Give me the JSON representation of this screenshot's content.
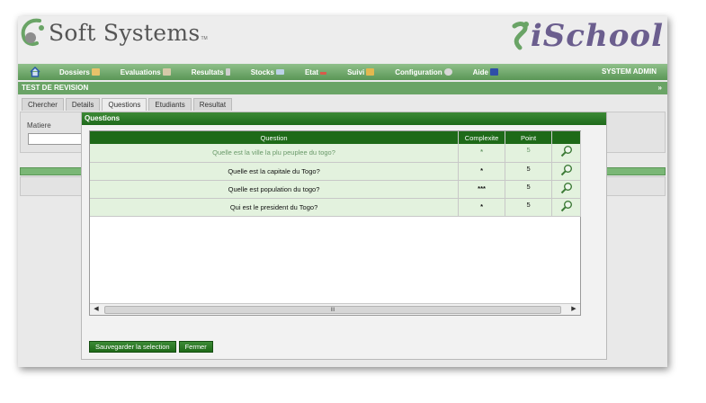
{
  "brand": {
    "name": "Soft Systems",
    "tm": "TM",
    "product": "iSchool"
  },
  "menu": {
    "items": [
      {
        "label": "Dossiers",
        "icon": "folder-icon",
        "color": "#e8c26a"
      },
      {
        "label": "Evaluations",
        "icon": "evaluation-icon",
        "color": "#d6c9a8"
      },
      {
        "label": "Resultats",
        "icon": "results-icon",
        "color": "#cfcfcf"
      },
      {
        "label": "Stocks",
        "icon": "stocks-icon",
        "color": "#bcd2e8"
      },
      {
        "label": "Etat",
        "icon": "chart-icon",
        "color": "#d95a4a"
      },
      {
        "label": "Suivi",
        "icon": "follow-icon",
        "color": "#e3b84f"
      },
      {
        "label": "Configuration",
        "icon": "gear-icon",
        "color": "#d8d8d8"
      },
      {
        "label": "Aide",
        "icon": "help-icon",
        "color": "#2f4fa8"
      }
    ],
    "user": "SYSTEM ADMIN"
  },
  "title": {
    "text": "TEST DE REVISION",
    "arrow": "»"
  },
  "tabs": [
    "Chercher",
    "Details",
    "Questions",
    "Etudiants",
    "Resultat"
  ],
  "form": {
    "matiere_label": "Matiere"
  },
  "dialog": {
    "title": "Questions",
    "columns": {
      "question": "Question",
      "complexite": "Complexite",
      "point": "Point"
    },
    "rows": [
      {
        "question": "Quelle est la ville la plu peuplee du togo?",
        "complexite": "*",
        "point": "5"
      },
      {
        "question": "Quelle est la capitale du Togo?",
        "complexite": "*",
        "point": "5"
      },
      {
        "question": "Quelle est population du togo?",
        "complexite": "***",
        "point": "5"
      },
      {
        "question": "Qui est le president du Togo?",
        "complexite": "*",
        "point": "5"
      }
    ],
    "scroll": {
      "left": "◀",
      "right": "▶",
      "thumb": "III"
    },
    "buttons": {
      "save": "Sauvegarder la selection",
      "close": "Fermer"
    }
  },
  "colors": {
    "menu_green": "#5a9656",
    "header_green": "#1e6a18",
    "row_bg": "#e3f2de",
    "brand_purple": "#6b5e8e"
  }
}
